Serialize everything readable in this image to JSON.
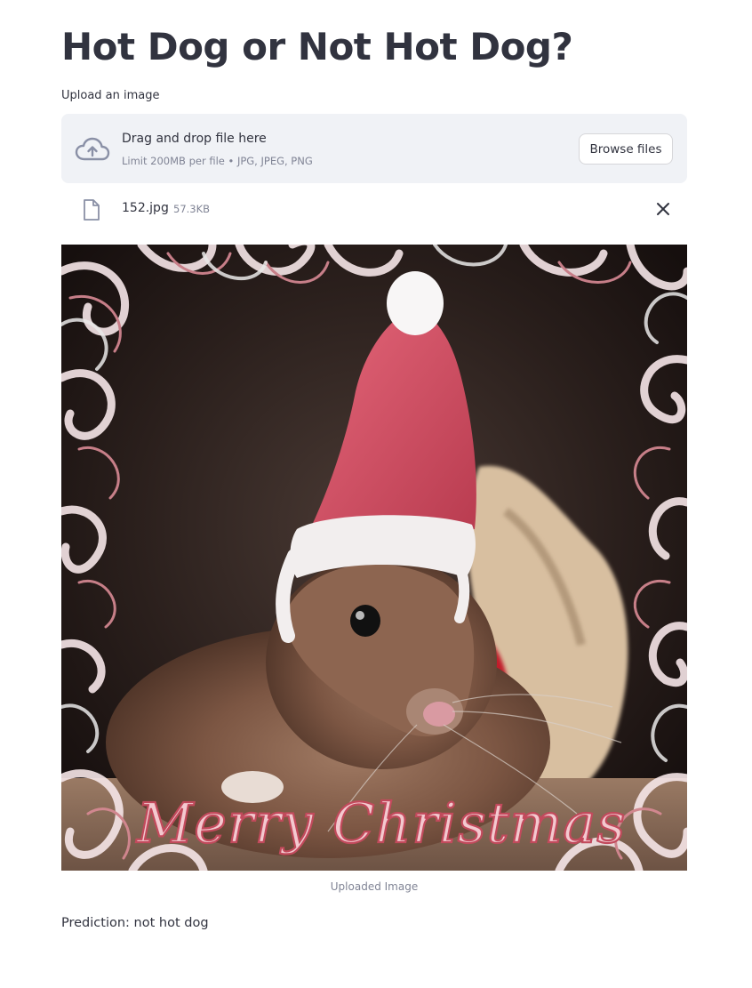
{
  "page": {
    "title": "Hot Dog or Not Hot Dog?"
  },
  "uploader": {
    "label": "Upload an image",
    "drop_title": "Drag and drop file here",
    "limit_text": "Limit 200MB per file • JPG, JPEG, PNG",
    "browse_label": "Browse files",
    "icon": "cloud-upload-icon"
  },
  "file": {
    "name": "152.jpg",
    "size": "57.3KB",
    "icon": "file-icon",
    "remove_icon": "close-icon"
  },
  "image": {
    "caption": "Uploaded Image",
    "overlay_text": "Merry Christmas"
  },
  "result": {
    "prediction": "Prediction: not hot dog"
  },
  "colors": {
    "text": "#31333f",
    "muted": "#808495",
    "dropzone_bg": "#f0f2f6",
    "hat_red": "#d9495c",
    "frame_pink": "#e8a3aa"
  }
}
